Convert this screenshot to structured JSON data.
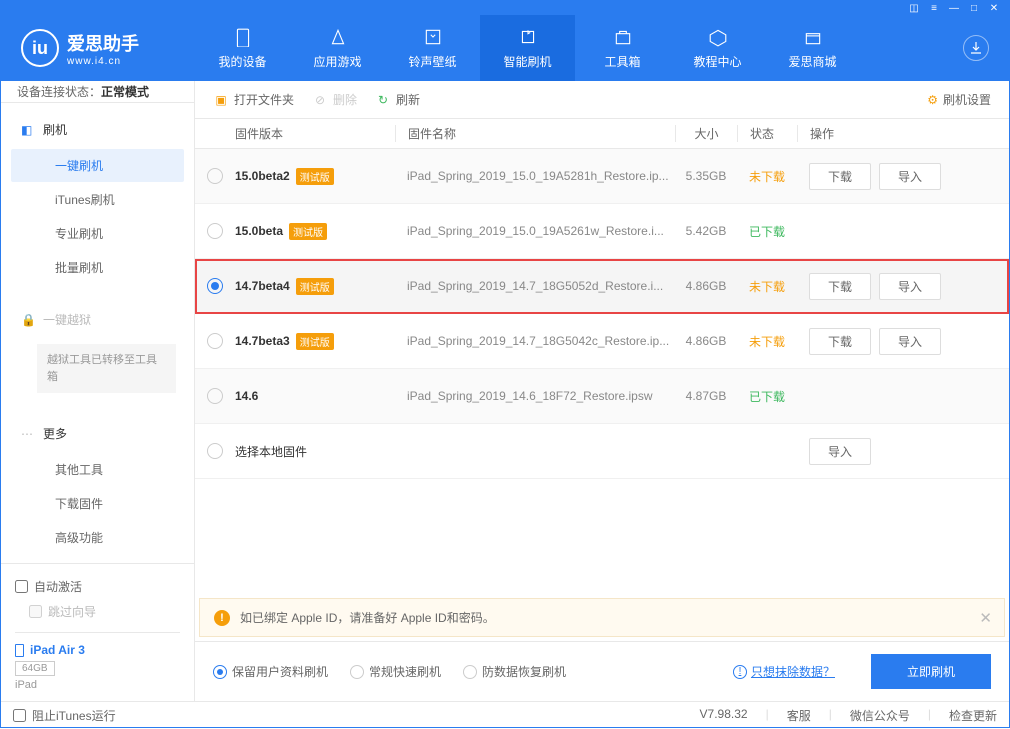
{
  "app": {
    "name": "爱思助手",
    "url": "www.i4.cn"
  },
  "window_controls": [
    "■",
    "≡",
    "—",
    "□",
    "✕"
  ],
  "nav": [
    {
      "label": "我的设备"
    },
    {
      "label": "应用游戏"
    },
    {
      "label": "铃声壁纸"
    },
    {
      "label": "智能刷机",
      "active": true
    },
    {
      "label": "工具箱"
    },
    {
      "label": "教程中心"
    },
    {
      "label": "爱思商城"
    }
  ],
  "conn": {
    "label": "设备连接状态：",
    "value": "正常模式"
  },
  "sidebar": {
    "flash": {
      "head": "刷机",
      "subs": [
        "一键刷机",
        "iTunes刷机",
        "专业刷机",
        "批量刷机"
      ]
    },
    "jailbreak": {
      "head": "一键越狱",
      "note": "越狱工具已转移至工具箱"
    },
    "more": {
      "head": "更多",
      "subs": [
        "其他工具",
        "下载固件",
        "高级功能"
      ]
    },
    "auto_activate": "自动激活",
    "skip_guide": "跳过向导",
    "device": {
      "name": "iPad Air 3",
      "storage": "64GB",
      "type": "iPad"
    }
  },
  "toolbar": {
    "open": "打开文件夹",
    "delete": "删除",
    "refresh": "刷新",
    "settings": "刷机设置"
  },
  "columns": {
    "ver": "固件版本",
    "name": "固件名称",
    "size": "大小",
    "status": "状态",
    "ops": "操作"
  },
  "beta_tag": "测试版",
  "buttons": {
    "download": "下载",
    "import": "导入"
  },
  "status": {
    "not": "未下载",
    "done": "已下载"
  },
  "firmware": [
    {
      "ver": "15.0beta2",
      "beta": true,
      "name": "iPad_Spring_2019_15.0_19A5281h_Restore.ip...",
      "size": "5.35GB",
      "status": "not",
      "ops": [
        "download",
        "import"
      ]
    },
    {
      "ver": "15.0beta",
      "beta": true,
      "name": "iPad_Spring_2019_15.0_19A5261w_Restore.i...",
      "size": "5.42GB",
      "status": "done",
      "ops": []
    },
    {
      "ver": "14.7beta4",
      "beta": true,
      "name": "iPad_Spring_2019_14.7_18G5052d_Restore.i...",
      "size": "4.86GB",
      "status": "not",
      "ops": [
        "download",
        "import"
      ],
      "selected": true,
      "highlight": true
    },
    {
      "ver": "14.7beta3",
      "beta": true,
      "name": "iPad_Spring_2019_14.7_18G5042c_Restore.ip...",
      "size": "4.86GB",
      "status": "not",
      "ops": [
        "download",
        "import"
      ]
    },
    {
      "ver": "14.6",
      "beta": false,
      "name": "iPad_Spring_2019_14.6_18F72_Restore.ipsw",
      "size": "4.87GB",
      "status": "done",
      "ops": []
    }
  ],
  "local_row": "选择本地固件",
  "warning": "如已绑定 Apple ID，请准备好 Apple ID和密码。",
  "flash_opts": [
    "保留用户资料刷机",
    "常规快速刷机",
    "防数据恢复刷机"
  ],
  "erase_link": "只想抹除数据？",
  "flash_now": "立即刷机",
  "footer": {
    "block_itunes": "阻止iTunes运行",
    "version": "V7.98.32",
    "service": "客服",
    "wechat": "微信公众号",
    "update": "检查更新"
  }
}
